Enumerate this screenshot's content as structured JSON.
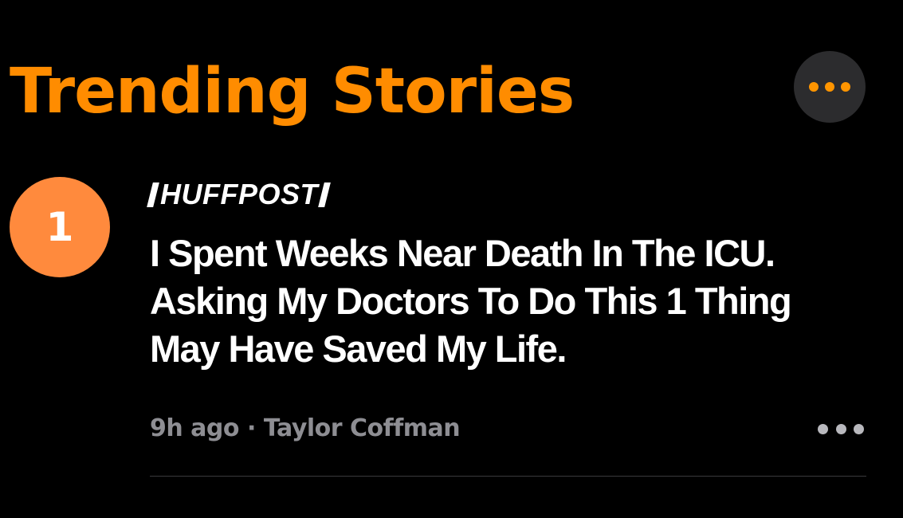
{
  "section": {
    "title": "Trending Stories",
    "more_icon": "ellipsis-icon",
    "accent_color": "#ff8c00"
  },
  "story": {
    "rank": "1",
    "rank_color": "#ff8a3d",
    "publisher": "HUFFPOST",
    "headline": "I Spent Weeks Near Death In The ICU. Asking My Doctors To Do This 1 Thing May Have Saved My Life.",
    "time_ago": "9h ago",
    "separator": "·",
    "author": "Taylor Coffman",
    "more_icon": "ellipsis-icon"
  }
}
